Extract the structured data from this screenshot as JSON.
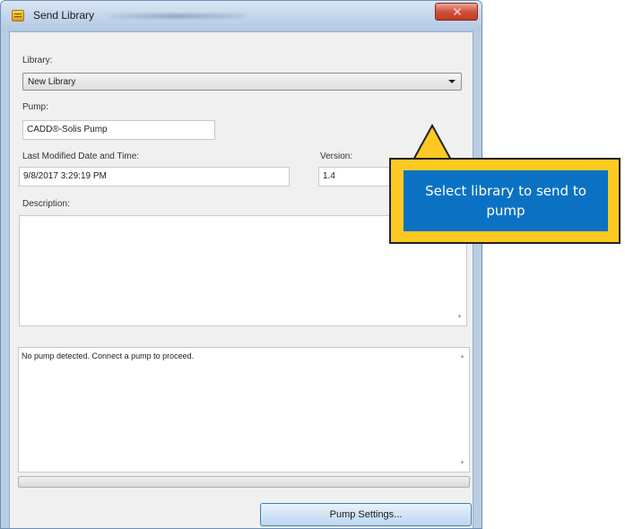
{
  "window": {
    "title": "Send Library"
  },
  "form": {
    "library_label": "Library:",
    "library_value": "New Library",
    "pump_label": "Pump:",
    "pump_value": "CADD®-Solis Pump",
    "modified_label": "Last Modified Date and Time:",
    "modified_value": "9/8/2017 3:29:19 PM",
    "version_label": "Version:",
    "version_value": "1.4",
    "description_label": "Description:",
    "description_value": ""
  },
  "status": {
    "message": "No pump detected. Connect a pump to proceed."
  },
  "buttons": {
    "pump_settings": "Pump Settings..."
  },
  "callout": {
    "text": "Select library to send to pump"
  },
  "colors": {
    "callout_border": "#ffc923",
    "callout_fill": "#0b72c3"
  }
}
